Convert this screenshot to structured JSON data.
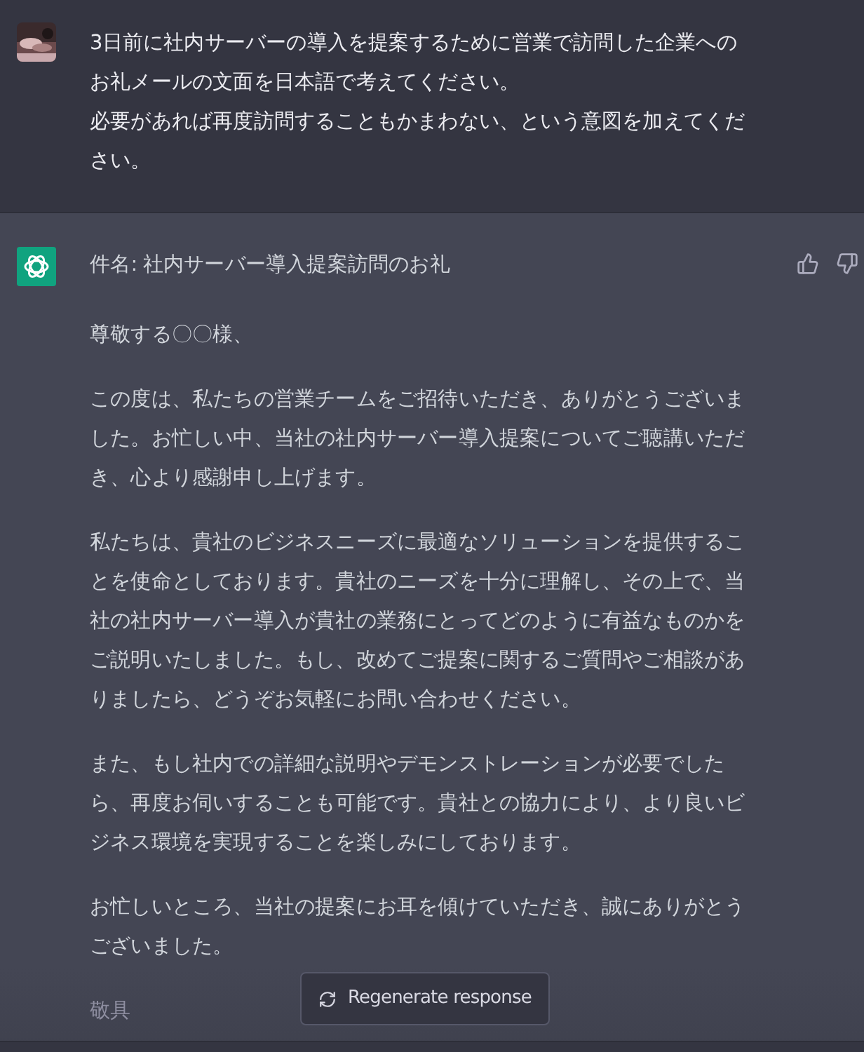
{
  "user_message": {
    "lines": [
      "3日前に社内サーバーの導入を提案するために営業で訪問した企業へのお礼メールの文面を日本語で考えてください。",
      "必要があれば再度訪問することもかまわない、という意図を加えてください。"
    ]
  },
  "assistant_message": {
    "subject": "件名: 社内サーバー導入提案訪問のお礼",
    "paragraphs": [
      "尊敬する〇〇様、",
      "この度は、私たちの営業チームをご招待いただき、ありがとうございました。お忙しい中、当社の社内サーバー導入提案についてご聴講いただき、心より感謝申し上げます。",
      "私たちは、貴社のビジネスニーズに最適なソリューションを提供することを使命としております。貴社のニーズを十分に理解し、その上で、当社の社内サーバー導入が貴社の業務にとってどのように有益なものかをご説明いたしました。もし、改めてご提案に関するご質問やご相談がありましたら、どうぞお気軽にお問い合わせください。",
      "また、もし社内での詳細な説明やデモンストレーションが必要でしたら、再度お伺いすることも可能です。貴社との協力により、より良いビジネス環境を実現することを楽しみにしております。",
      "お忙しいところ、当社の提案にお耳を傾けていただき、誠にありがとうございました。",
      "敬具"
    ]
  },
  "regenerate_button": {
    "label": "Regenerate response"
  }
}
